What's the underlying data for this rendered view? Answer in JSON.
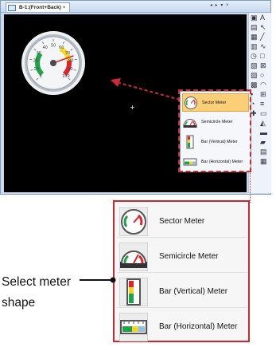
{
  "window": {
    "tab_label": "B-1:(Front+Back)",
    "tab_close": "×",
    "tab_nav": "◂ ▸ ▾ ×"
  },
  "canvas": {
    "cursor_glyph": "+",
    "gauge": {
      "ticks": [
        "0",
        "10",
        "20",
        "30",
        "40",
        "50",
        "60",
        "70",
        "80",
        "90",
        "100"
      ],
      "needle_value": 76,
      "zones": {
        "green": [
          0,
          30
        ],
        "yellow": [
          60,
          80
        ],
        "red": [
          80,
          100
        ]
      }
    }
  },
  "popup": {
    "items": [
      {
        "label": "Sector Meter",
        "selected": true,
        "icon": "sector-meter-icon"
      },
      {
        "label": "Semicircle Meter",
        "selected": false,
        "icon": "semicircle-meter-icon"
      },
      {
        "label": "Bar (Vertical) Meter",
        "selected": false,
        "icon": "bar-vertical-meter-icon"
      },
      {
        "label": "Bar (Horizontal) Meter",
        "selected": false,
        "icon": "bar-horizontal-meter-icon"
      }
    ]
  },
  "enlarged_menu": {
    "items": [
      {
        "label": "Sector Meter",
        "icon": "sector-meter-icon"
      },
      {
        "label": "Semicircle Meter",
        "icon": "semicircle-meter-icon"
      },
      {
        "label": "Bar (Vertical) Meter",
        "icon": "bar-vertical-meter-icon"
      },
      {
        "label": "Bar (Horizontal) Meter",
        "icon": "bar-horizontal-meter-icon"
      }
    ]
  },
  "callout": {
    "line1": "Select meter",
    "line2": "shape"
  },
  "colors": {
    "highlight": "#c8282e",
    "selected_item": "#fbcf78",
    "gauge_green": "#1fa34a",
    "gauge_yellow": "#f0d428",
    "gauge_red": "#e0242a"
  }
}
